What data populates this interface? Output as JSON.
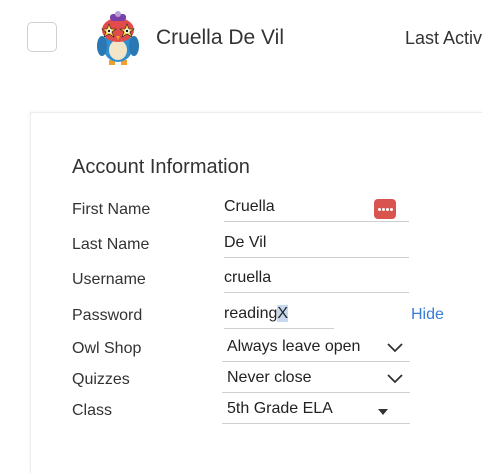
{
  "header": {
    "student_name": "Cruella De Vil",
    "last_active_label": "Last Activ"
  },
  "account": {
    "title": "Account Information",
    "first_name": {
      "label": "First Name",
      "value": "Cruella"
    },
    "last_name": {
      "label": "Last Name",
      "value": "De Vil"
    },
    "username": {
      "label": "Username",
      "value": "cruella"
    },
    "password": {
      "label": "Password",
      "value_main": "reading",
      "value_selected": "X",
      "toggle_label": "Hide"
    },
    "owl_shop": {
      "label": "Owl Shop",
      "value": "Always leave open"
    },
    "quizzes": {
      "label": "Quizzes",
      "value": "Never close"
    },
    "class": {
      "label": "Class",
      "value": "5th Grade ELA"
    }
  },
  "icons": {
    "avatar": "owl-avatar-icon",
    "password_manager": "password-manager-icon",
    "dropdown": "chevron-down-icon",
    "select_caret": "caret-down-icon"
  },
  "colors": {
    "accent": "#3a7bd5",
    "badge": "#d9534f",
    "selection": "#c7d9f0"
  }
}
